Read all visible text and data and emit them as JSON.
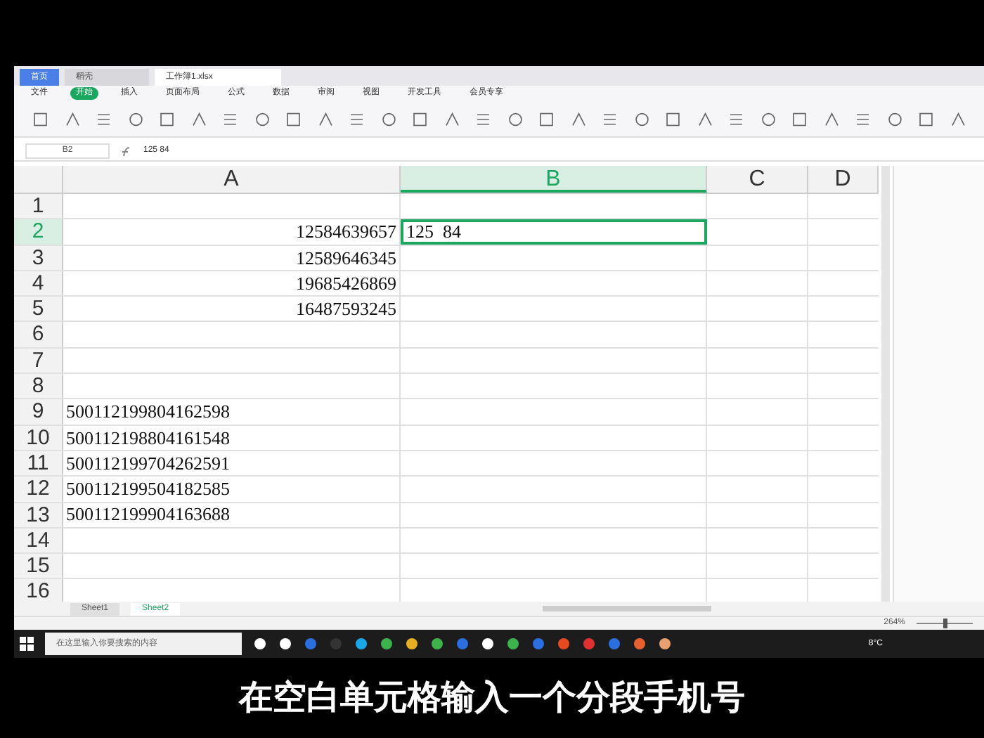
{
  "title_tabs": [
    {
      "label": "首页",
      "selected": false
    },
    {
      "label": "稻壳",
      "selected": false
    },
    {
      "label": "工作簿1.xlsx",
      "selected": true
    }
  ],
  "menu": [
    {
      "label": "文件",
      "selected": false
    },
    {
      "label": "开始",
      "selected": true
    },
    {
      "label": "插入",
      "selected": false
    },
    {
      "label": "页面布局",
      "selected": false
    },
    {
      "label": "公式",
      "selected": false
    },
    {
      "label": "数据",
      "selected": false
    },
    {
      "label": "审阅",
      "selected": false
    },
    {
      "label": "视图",
      "selected": false
    },
    {
      "label": "开发工具",
      "selected": false
    },
    {
      "label": "会员专享",
      "selected": false
    }
  ],
  "formula_bar": {
    "cell": "B2",
    "value": "125 84"
  },
  "columns": [
    {
      "label": "A",
      "selected": false
    },
    {
      "label": "B",
      "selected": true
    },
    {
      "label": "C",
      "selected": false
    },
    {
      "label": "D",
      "selected": false
    }
  ],
  "rows": [
    {
      "label": "1",
      "selected": false
    },
    {
      "label": "2",
      "selected": true,
      "a": {
        "text": "12584639657",
        "kind": "number"
      },
      "b": "125  84"
    },
    {
      "label": "3",
      "selected": false,
      "a": {
        "text": "12589646345",
        "kind": "number"
      }
    },
    {
      "label": "4",
      "selected": false,
      "a": {
        "text": "19685426869",
        "kind": "number"
      }
    },
    {
      "label": "5",
      "selected": false,
      "a": {
        "text": "16487593245",
        "kind": "number"
      }
    },
    {
      "label": "6",
      "selected": false
    },
    {
      "label": "7",
      "selected": false
    },
    {
      "label": "8",
      "selected": false
    },
    {
      "label": "9",
      "selected": false,
      "a": {
        "text": "500112199804162598",
        "kind": "text"
      }
    },
    {
      "label": "10",
      "selected": false,
      "a": {
        "text": "500112198804161548",
        "kind": "text"
      }
    },
    {
      "label": "11",
      "selected": false,
      "a": {
        "text": "500112199704262591",
        "kind": "text"
      }
    },
    {
      "label": "12",
      "selected": false,
      "a": {
        "text": "500112199504182585",
        "kind": "text"
      }
    },
    {
      "label": "13",
      "selected": false,
      "a": {
        "text": "500112199904163688",
        "kind": "text"
      }
    },
    {
      "label": "14",
      "selected": false
    },
    {
      "label": "15",
      "selected": false
    },
    {
      "label": "16",
      "selected": false
    }
  ],
  "sheets": [
    {
      "label": "Sheet1",
      "selected": false
    },
    {
      "label": "Sheet2",
      "selected": true
    }
  ],
  "status": {
    "zoom": "264%",
    "level": 0.5
  },
  "taskbar": {
    "search_placeholder": "在这里输入你要搜索的内容",
    "temperature": "8°C"
  },
  "caption": "在空白单元格输入一个分段手机号"
}
